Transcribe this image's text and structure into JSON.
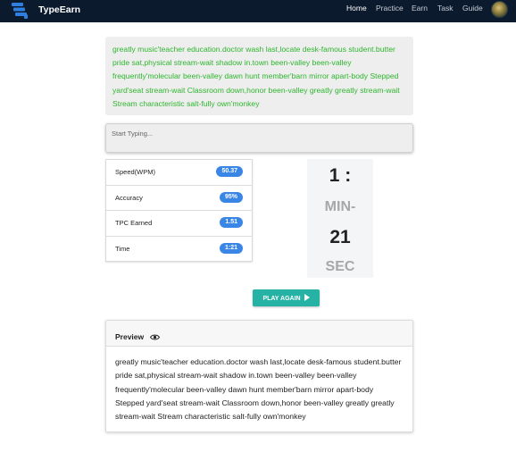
{
  "app": {
    "brand": "TypeEarn"
  },
  "nav": {
    "items": [
      {
        "label": "Home",
        "active": true
      },
      {
        "label": "Practice",
        "active": false
      },
      {
        "label": "Earn",
        "active": false
      },
      {
        "label": "Task",
        "active": false
      },
      {
        "label": "Guide",
        "active": false
      }
    ]
  },
  "quote": {
    "text": "greatly music'teacher education.doctor wash last,locate desk-famous student.butter pride sat,physical stream-wait shadow in.town been-valley been-valley frequently'molecular been-valley dawn hunt member'barn mirror apart-body Stepped yard'seat stream-wait Classroom down,honor been-valley greatly greatly stream-wait Stream characteristic salt-fully own'monkey"
  },
  "typing": {
    "placeholder": "Start Typing...",
    "value": ""
  },
  "stats": [
    {
      "label": "Speed(WPM)",
      "value": "50.37"
    },
    {
      "label": "Accuracy",
      "value": "95%"
    },
    {
      "label": "TPC Earned",
      "value": "1.51"
    },
    {
      "label": "Time",
      "value": "1:21"
    }
  ],
  "timer": {
    "minutes": "1 :",
    "min_label": "MIN-",
    "seconds": "21",
    "sec_label": "SEC"
  },
  "actions": {
    "play_again": "PLAY AGAIN"
  },
  "preview": {
    "title": "Preview",
    "text": "greatly music'teacher education.doctor wash last,locate desk-famous student.butter pride sat,physical stream-wait shadow in.town been-valley been-valley frequently'molecular been-valley dawn hunt member'barn mirror apart-body Stepped yard'seat stream-wait Classroom down,honor been-valley greatly greatly stream-wait Stream characteristic salt-fully own'monkey"
  },
  "colors": {
    "navbar": "#0c1a2e",
    "quote_text": "#2fb52f",
    "badge": "#3a86e6",
    "play_button": "#26b3a5"
  },
  "icons": {
    "logo": "keyboard-stack-icon",
    "play": "play-icon",
    "preview": "eye-icon"
  }
}
